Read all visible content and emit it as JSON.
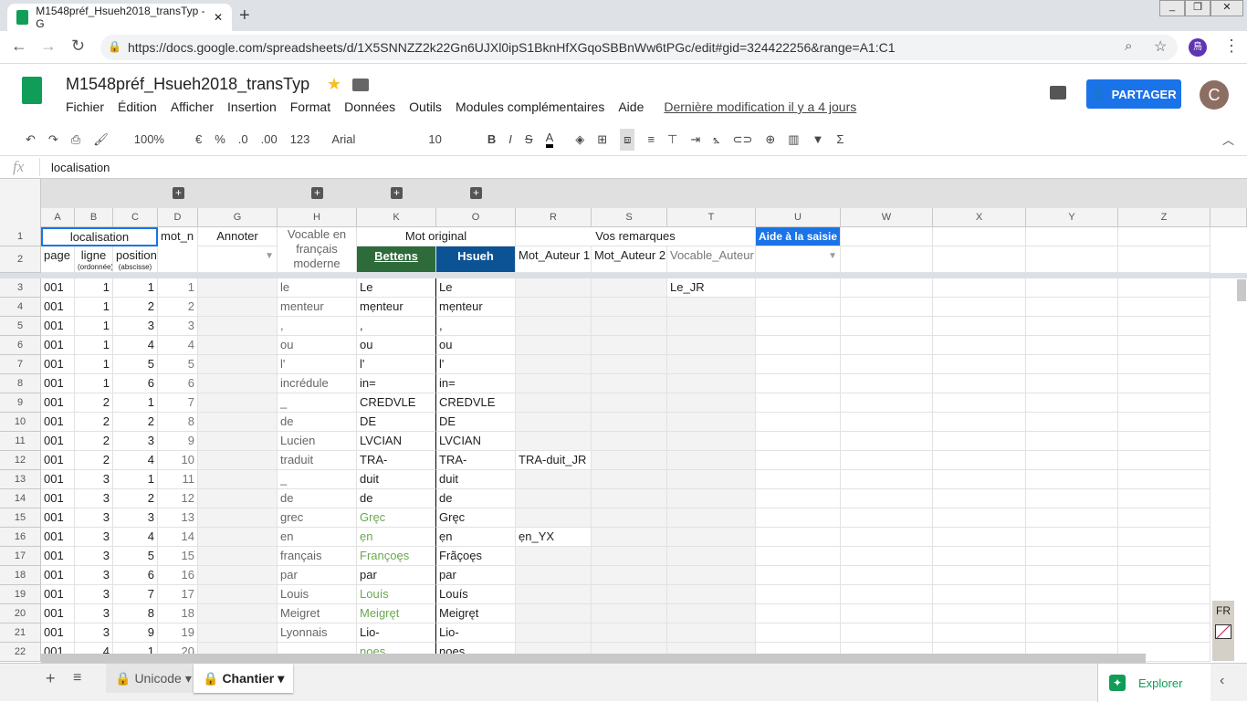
{
  "browser": {
    "tab_title": "M1548préf_Hsueh2018_transTyp - G",
    "url": "https://docs.google.com/spreadsheets/d/1X5SNNZZ2k22Gn6UJXl0ipS1BknHfXGqoSBBnWw6tPGc/edit#gid=324422256&range=A1:C1",
    "profile": "鳥"
  },
  "doc": {
    "title": "M1548préf_Hsueh2018_transTyp",
    "menu": [
      "Fichier",
      "Édition",
      "Afficher",
      "Insertion",
      "Format",
      "Données",
      "Outils",
      "Modules complémentaires",
      "Aide"
    ],
    "last_modified": "Dernière modification il y a 4 jours",
    "share": "PARTAGER",
    "avatar": "C"
  },
  "toolbar": {
    "zoom": "100%",
    "currency": "€",
    "percent": "%",
    "dec_less": ".0",
    "dec_more": ".00",
    "format": "123",
    "font": "Arial",
    "size": "10",
    "bold": "B",
    "italic": "I",
    "strike": "S",
    "text_color": "A",
    "sum": "Σ"
  },
  "formula": {
    "fx": "fx",
    "value": "localisation"
  },
  "columns": [
    "A",
    "B",
    "C",
    "D",
    "G",
    "H",
    "K",
    "O",
    "R",
    "S",
    "T",
    "U",
    "W",
    "X",
    "Y",
    "Z"
  ],
  "headers": {
    "localisation": "localisation",
    "mot_n": "mot_n",
    "annoter": "Annoter",
    "vocable": "Vocable en français moderne",
    "mot_original": "Mot original",
    "vos_remarques": "Vos remarques",
    "aide": "Aide à la saisie",
    "page": "page",
    "ligne": "ligne",
    "ligne_sub": "(ordonnée)",
    "position": "position",
    "position_sub": "(abscisse)",
    "bettens": "Bettens",
    "hsueh": "Hsueh",
    "mot_auteur1": "Mot_Auteur 1",
    "mot_auteur2": "Mot_Auteur 2",
    "vocable_auteur": "Vocable_Auteur"
  },
  "colors": {
    "selection": "#1a73e8",
    "bettens_bg": "#2e6b3a",
    "hsueh_bg": "#0b5394",
    "aide_bg": "#1a73e8",
    "green_text": "#6aa84f"
  },
  "rows": [
    {
      "n": "3",
      "a": "001",
      "b": "1",
      "c": "1",
      "d": "1",
      "h": "le",
      "k": "Le",
      "o": "Le",
      "r": "",
      "t": "Le_JR",
      "kg": false
    },
    {
      "n": "4",
      "a": "001",
      "b": "1",
      "c": "2",
      "d": "2",
      "h": "menteur",
      "k": "mẹnteur",
      "o": "mẹnteur",
      "r": "",
      "t": "",
      "kg": false
    },
    {
      "n": "5",
      "a": "001",
      "b": "1",
      "c": "3",
      "d": "3",
      "h": ",",
      "k": ",",
      "o": ",",
      "r": "",
      "t": "",
      "kg": false
    },
    {
      "n": "6",
      "a": "001",
      "b": "1",
      "c": "4",
      "d": "4",
      "h": "ou",
      "k": "ou",
      "o": "ou",
      "r": "",
      "t": "",
      "kg": false
    },
    {
      "n": "7",
      "a": "001",
      "b": "1",
      "c": "5",
      "d": "5",
      "h": "l'",
      "k": "l'",
      "o": "l'",
      "r": "",
      "t": "",
      "kg": false
    },
    {
      "n": "8",
      "a": "001",
      "b": "1",
      "c": "6",
      "d": "6",
      "h": "incrédule",
      "k": "in=",
      "o": "in=",
      "r": "",
      "t": "",
      "kg": false
    },
    {
      "n": "9",
      "a": "001",
      "b": "2",
      "c": "1",
      "d": "7",
      "h": "_",
      "k": "CREDVLE",
      "o": "CREDVLE",
      "r": "",
      "t": "",
      "kg": false
    },
    {
      "n": "10",
      "a": "001",
      "b": "2",
      "c": "2",
      "d": "8",
      "h": "de",
      "k": "DE",
      "o": "DE",
      "r": "",
      "t": "",
      "kg": false
    },
    {
      "n": "11",
      "a": "001",
      "b": "2",
      "c": "3",
      "d": "9",
      "h": "Lucien",
      "k": "LVCIAN",
      "o": "LVCIAN",
      "r": "",
      "t": "",
      "kg": false
    },
    {
      "n": "12",
      "a": "001",
      "b": "2",
      "c": "4",
      "d": "10",
      "h": "traduit",
      "k": "TRA-",
      "o": "TRA-",
      "r": "TRA-duit_JR",
      "t": "",
      "kg": false
    },
    {
      "n": "13",
      "a": "001",
      "b": "3",
      "c": "1",
      "d": "11",
      "h": "_",
      "k": "duit",
      "o": "duit",
      "r": "",
      "t": "",
      "kg": false
    },
    {
      "n": "14",
      "a": "001",
      "b": "3",
      "c": "2",
      "d": "12",
      "h": "de",
      "k": "de",
      "o": "de",
      "r": "",
      "t": "",
      "kg": false
    },
    {
      "n": "15",
      "a": "001",
      "b": "3",
      "c": "3",
      "d": "13",
      "h": "grec",
      "k": "Gręc",
      "o": "Gręc",
      "r": "",
      "t": "",
      "kg": true
    },
    {
      "n": "16",
      "a": "001",
      "b": "3",
      "c": "4",
      "d": "14",
      "h": "en",
      "k": "ẹn",
      "o": "ẹn",
      "r": "ẹn_YX",
      "t": "",
      "kg": true
    },
    {
      "n": "17",
      "a": "001",
      "b": "3",
      "c": "5",
      "d": "15",
      "h": "français",
      "k": "Françoęs",
      "o": "Frãçoęs",
      "r": "",
      "t": "",
      "kg": true
    },
    {
      "n": "18",
      "a": "001",
      "b": "3",
      "c": "6",
      "d": "16",
      "h": "par",
      "k": "par",
      "o": "par",
      "r": "",
      "t": "",
      "kg": false
    },
    {
      "n": "19",
      "a": "001",
      "b": "3",
      "c": "7",
      "d": "17",
      "h": "Louis",
      "k": "Louís",
      "o": "Louís",
      "r": "",
      "t": "",
      "kg": true
    },
    {
      "n": "20",
      "a": "001",
      "b": "3",
      "c": "8",
      "d": "18",
      "h": "Meigret",
      "k": "Meigręt",
      "o": "Meigręt",
      "r": "",
      "t": "",
      "kg": true
    },
    {
      "n": "21",
      "a": "001",
      "b": "3",
      "c": "9",
      "d": "19",
      "h": "Lyonnais",
      "k": "Lio-",
      "o": "Lio-",
      "r": "",
      "t": "",
      "kg": false
    },
    {
      "n": "22",
      "a": "001",
      "b": "4",
      "c": "1",
      "d": "20",
      "h": "",
      "k": "noes",
      "o": "noes",
      "r": "",
      "t": "",
      "kg": true
    }
  ],
  "sheets": {
    "tabs": [
      {
        "label": "Unicode",
        "active": false
      },
      {
        "label": "Chantier",
        "active": true
      }
    ],
    "explorer": "Explorer",
    "ime": "FR"
  }
}
